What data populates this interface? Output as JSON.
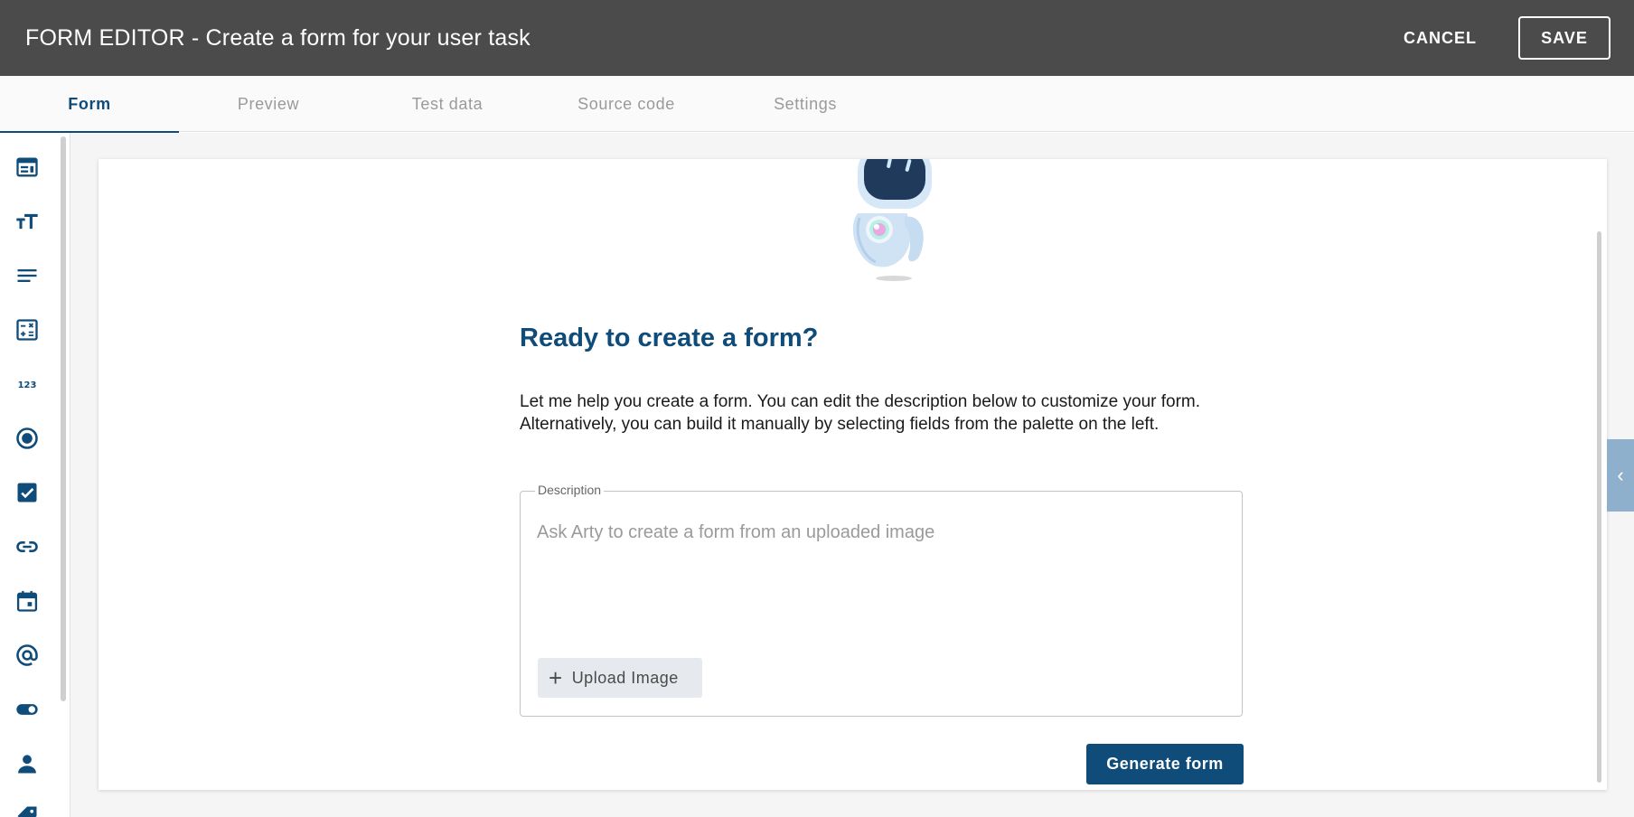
{
  "header": {
    "title": "FORM EDITOR - Create a form for your user task",
    "cancel_label": "CANCEL",
    "save_label": "SAVE"
  },
  "tabs": [
    {
      "label": "Form",
      "active": true
    },
    {
      "label": "Preview",
      "active": false
    },
    {
      "label": "Test data",
      "active": false
    },
    {
      "label": "Source code",
      "active": false
    },
    {
      "label": "Settings",
      "active": false
    }
  ],
  "palette": {
    "items": [
      {
        "icon": "panel-icon"
      },
      {
        "icon": "text-size-icon"
      },
      {
        "icon": "paragraph-icon"
      },
      {
        "icon": "calculator-icon"
      },
      {
        "icon": "number-icon"
      },
      {
        "icon": "radio-icon"
      },
      {
        "icon": "checkbox-icon"
      },
      {
        "icon": "link-icon"
      },
      {
        "icon": "calendar-icon"
      },
      {
        "icon": "email-icon"
      },
      {
        "icon": "toggle-icon"
      },
      {
        "icon": "person-icon"
      },
      {
        "icon": "tag-icon"
      }
    ],
    "accent": "#0f4c7a"
  },
  "main": {
    "heading": "Ready to create a form?",
    "intro_line1": "Let me help you create a form. You can edit the description below to customize your form.",
    "intro_line2": "Alternatively, you can build it manually by selecting fields from the palette on the left.",
    "description": {
      "label": "Description",
      "placeholder": "Ask Arty to create a form from an uploaded image",
      "value": ""
    },
    "upload_label": "Upload Image",
    "generate_label": "Generate form"
  },
  "colors": {
    "header_bg": "#4b4b4b",
    "primary": "#0f4c7a",
    "toggle_bg": "#8fb0cc"
  }
}
